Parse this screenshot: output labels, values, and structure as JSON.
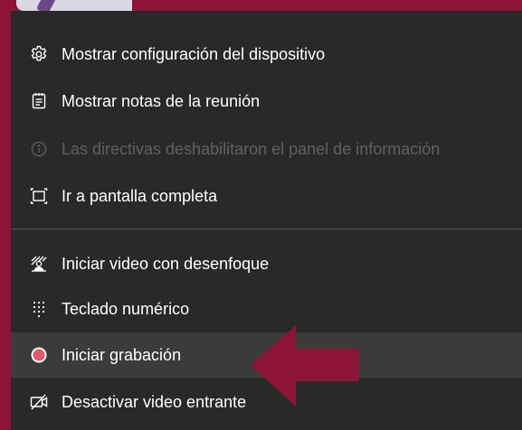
{
  "menu": {
    "items": [
      {
        "label": "Mostrar configuración del dispositivo",
        "icon": "gear-icon",
        "enabled": true
      },
      {
        "label": "Mostrar notas de la reunión",
        "icon": "notes-icon",
        "enabled": true
      },
      {
        "label": "Las directivas deshabilitaron el panel de información",
        "icon": "info-icon",
        "enabled": false
      },
      {
        "label": "Ir a pantalla completa",
        "icon": "fullscreen-icon",
        "enabled": true
      },
      {
        "label": "Iniciar video con desenfoque",
        "icon": "blur-background-icon",
        "enabled": true
      },
      {
        "label": "Teclado numérico",
        "icon": "dialpad-icon",
        "enabled": true
      },
      {
        "label": "Iniciar grabación",
        "icon": "record-icon",
        "enabled": true,
        "highlighted": true
      },
      {
        "label": "Desactivar video entrante",
        "icon": "video-off-icon",
        "enabled": true
      }
    ]
  },
  "colors": {
    "frame": "#8c1437",
    "menu_background": "#292929",
    "highlight_background": "#3b3b3b",
    "text": "#ffffff",
    "disabled_text": "#606060",
    "record_dot": "#e25766",
    "arrow": "#8c1437"
  }
}
